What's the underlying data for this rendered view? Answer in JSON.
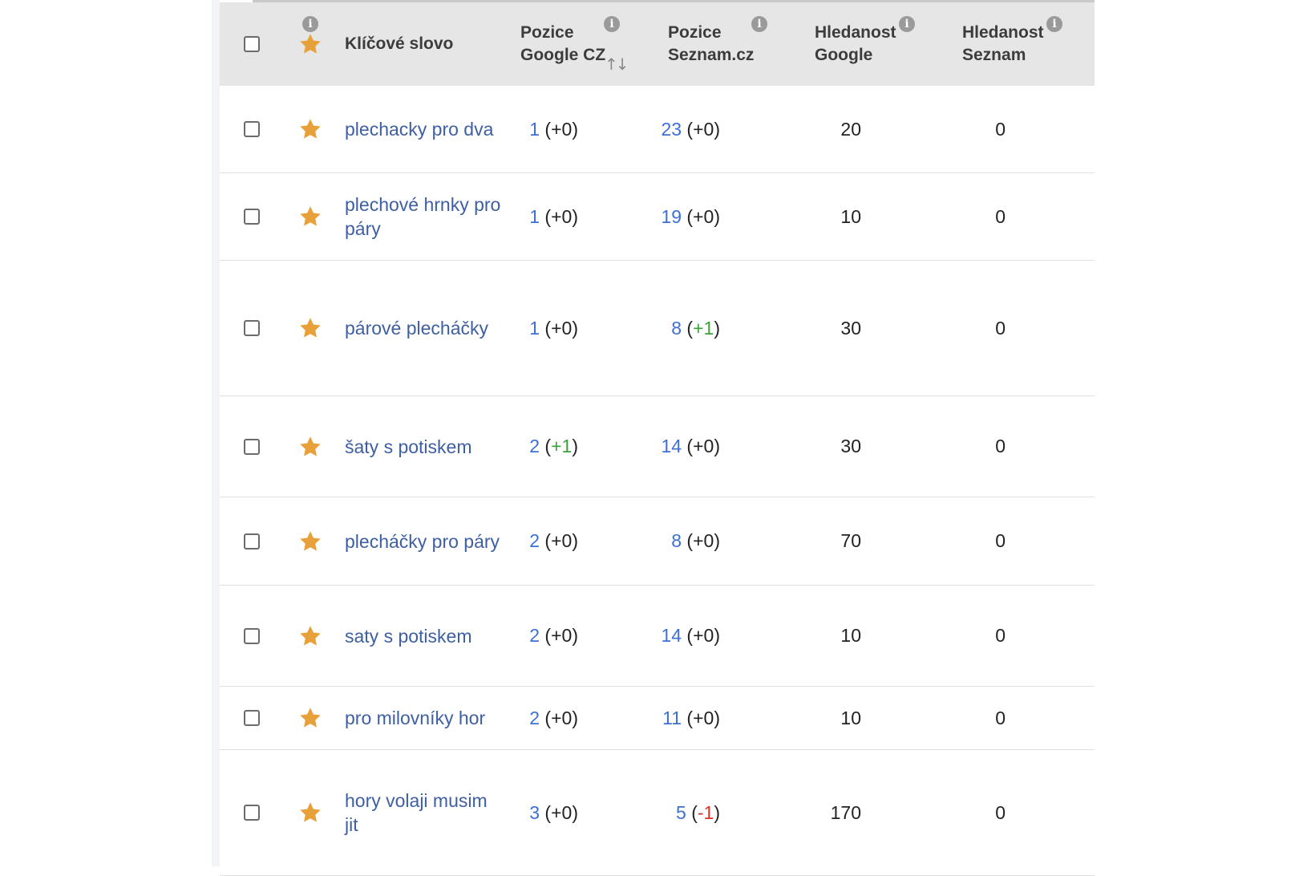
{
  "header": {
    "keyword": "Klíčové slovo",
    "google_pos": [
      "Pozice",
      "Google CZ"
    ],
    "seznam_pos": [
      "Pozice",
      "Seznam.cz"
    ],
    "google_search": [
      "Hledanost",
      "Google"
    ],
    "seznam_search": [
      "Hledanost",
      "Seznam"
    ],
    "info_glyph": "i",
    "sort_glyph": "↑↓"
  },
  "colors": {
    "star": "#e8a13a",
    "link": "#3e5fa3",
    "positive": "#3aa33a",
    "negative": "#d8342a"
  },
  "rows": [
    {
      "keyword": [
        "plechacky pro dva"
      ],
      "g_pos": "1",
      "g_diff": "+0",
      "g_dir": "neutral",
      "s_pos": "23",
      "s_diff": "+0",
      "s_dir": "neutral",
      "g_search": "20",
      "s_search": "0"
    },
    {
      "keyword": [
        "plechové hrnky pro",
        "páry"
      ],
      "g_pos": "1",
      "g_diff": "+0",
      "g_dir": "neutral",
      "s_pos": "19",
      "s_diff": "+0",
      "s_dir": "neutral",
      "g_search": "10",
      "s_search": "0"
    },
    {
      "keyword": [
        "párové plecháčky"
      ],
      "g_pos": "1",
      "g_diff": "+0",
      "g_dir": "neutral",
      "s_pos": "8",
      "s_diff": "+1",
      "s_dir": "up",
      "g_search": "30",
      "s_search": "0"
    },
    {
      "keyword": [
        "šaty s potiskem"
      ],
      "g_pos": "2",
      "g_diff": "+1",
      "g_dir": "up",
      "s_pos": "14",
      "s_diff": "+0",
      "s_dir": "neutral",
      "g_search": "30",
      "s_search": "0"
    },
    {
      "keyword": [
        "plecháčky pro páry"
      ],
      "g_pos": "2",
      "g_diff": "+0",
      "g_dir": "neutral",
      "s_pos": "8",
      "s_diff": "+0",
      "s_dir": "neutral",
      "g_search": "70",
      "s_search": "0"
    },
    {
      "keyword": [
        "saty s potiskem"
      ],
      "g_pos": "2",
      "g_diff": "+0",
      "g_dir": "neutral",
      "s_pos": "14",
      "s_diff": "+0",
      "s_dir": "neutral",
      "g_search": "10",
      "s_search": "0"
    },
    {
      "keyword": [
        "pro milovníky hor"
      ],
      "g_pos": "2",
      "g_diff": "+0",
      "g_dir": "neutral",
      "s_pos": "11",
      "s_diff": "+0",
      "s_dir": "neutral",
      "g_search": "10",
      "s_search": "0"
    },
    {
      "keyword": [
        "hory volaji musim",
        "jit"
      ],
      "g_pos": "3",
      "g_diff": "+0",
      "g_dir": "neutral",
      "s_pos": "5",
      "s_diff": "-1",
      "s_dir": "down",
      "g_search": "170",
      "s_search": "0"
    }
  ]
}
